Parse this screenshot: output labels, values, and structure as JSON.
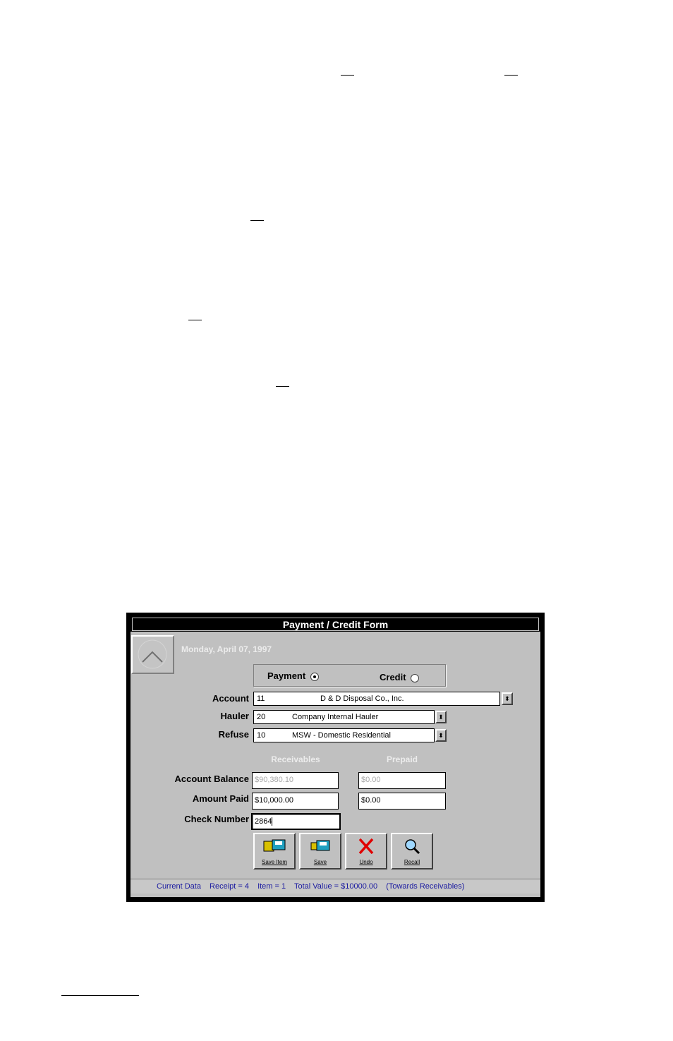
{
  "window": {
    "title": "Payment / Credit Form",
    "date": "Monday, April 07, 1997"
  },
  "type_group": {
    "payment_label": "Payment",
    "credit_label": "Credit",
    "selected": "Payment"
  },
  "account": {
    "label": "Account",
    "code": "11",
    "name": "D & D Disposal Co., Inc."
  },
  "hauler": {
    "label": "Hauler",
    "code": "20",
    "name": "Company Internal Hauler"
  },
  "refuse": {
    "label": "Refuse",
    "code": "10",
    "name": "MSW - Domestic Residential"
  },
  "columns": {
    "receivables": "Receivables",
    "prepaid": "Prepaid"
  },
  "balance": {
    "label": "Account Balance",
    "receivables": "$90,380.10",
    "prepaid": "$0.00"
  },
  "paid": {
    "label": "Amount Paid",
    "receivables": "$10,000.00",
    "prepaid": "$0.00"
  },
  "check": {
    "label": "Check Number",
    "value": "2864"
  },
  "buttons": {
    "save_item": "Save Item",
    "save": "Save",
    "undo": "Undo",
    "recall": "Recall"
  },
  "status": {
    "current": "Current Data",
    "receipt": "Receipt = 4",
    "item": "Item = 1",
    "total": "Total Value = $10000.00",
    "towards": "(Towards Receivables)"
  },
  "spinner_symbol": "⬍"
}
